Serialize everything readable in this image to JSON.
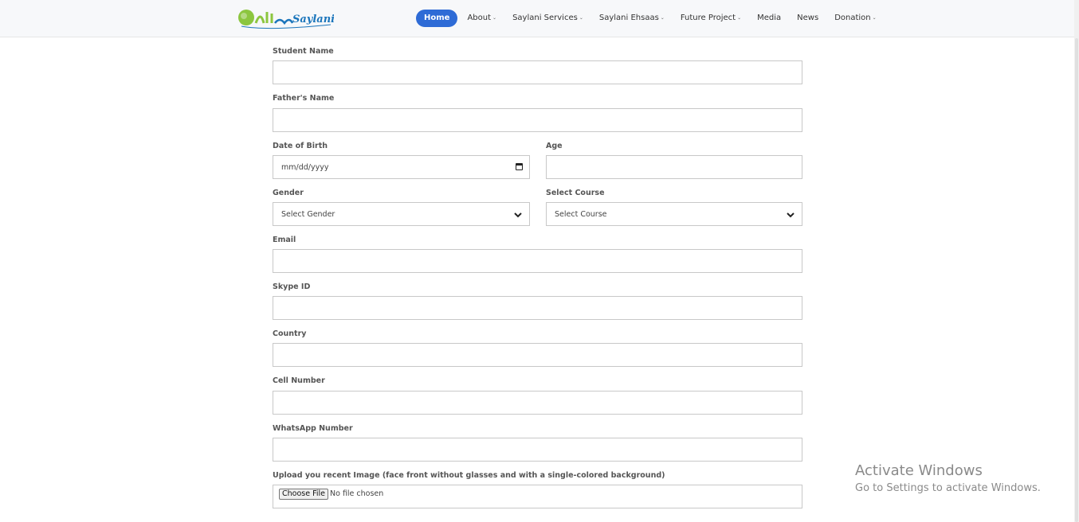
{
  "header": {
    "logo_text": "Saylani",
    "nav": [
      {
        "label": "Home",
        "dropdown": false,
        "active": true
      },
      {
        "label": "About",
        "dropdown": true
      },
      {
        "label": "Saylani Services",
        "dropdown": true
      },
      {
        "label": "Saylani Ehsaas",
        "dropdown": true
      },
      {
        "label": "Future Project",
        "dropdown": true
      },
      {
        "label": "Media",
        "dropdown": false
      },
      {
        "label": "News",
        "dropdown": false
      },
      {
        "label": "Donation",
        "dropdown": true
      }
    ],
    "chevron": "⌄"
  },
  "form": {
    "student_name": {
      "label": "Student Name",
      "value": ""
    },
    "father_name": {
      "label": "Father's Name",
      "value": ""
    },
    "dob": {
      "label": "Date of Birth",
      "placeholder": "mm/dd/yyyy"
    },
    "age": {
      "label": "Age",
      "value": ""
    },
    "gender": {
      "label": "Gender",
      "selected": "Select Gender"
    },
    "course": {
      "label": "Select Course",
      "selected": "Select Course"
    },
    "email": {
      "label": "Email",
      "value": ""
    },
    "skype": {
      "label": "Skype ID",
      "value": ""
    },
    "country": {
      "label": "Country",
      "value": ""
    },
    "cell": {
      "label": "Cell Number",
      "value": ""
    },
    "whatsapp": {
      "label": "WhatsApp Number",
      "value": ""
    },
    "image": {
      "label": "Upload you recent Image (face front without glasses and with a single-colored background)",
      "button": "Choose File",
      "status": "No file chosen"
    }
  },
  "watermark": {
    "title": "Activate Windows",
    "subtitle": "Go to Settings to activate Windows."
  },
  "colors": {
    "accent": "#2e6bd6",
    "logo_green": "#8cc63f",
    "logo_blue": "#1b75bb"
  }
}
